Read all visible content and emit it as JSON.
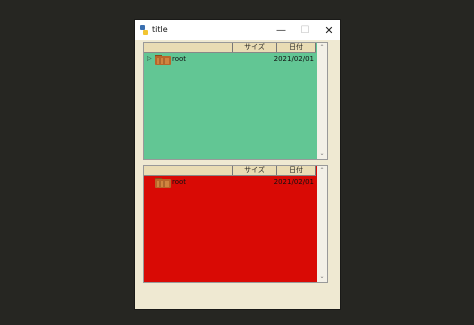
{
  "window": {
    "title": "title",
    "minimize": "—",
    "maximize": "☐",
    "close": "✕"
  },
  "panes": [
    {
      "background": "#62c694",
      "columns": {
        "name": "",
        "size": "サイズ",
        "date": "日付"
      },
      "rows": [
        {
          "expander": "▷",
          "name": "root",
          "size": "",
          "date": "2021/02/01"
        }
      ]
    },
    {
      "background": "#d90a05",
      "columns": {
        "name": "",
        "size": "サイズ",
        "date": "日付"
      },
      "rows": [
        {
          "expander": "",
          "name": "root",
          "size": "",
          "date": "2021/02/01"
        }
      ]
    }
  ],
  "icons": {
    "app": "python-icon",
    "folder": "folder-icon"
  }
}
